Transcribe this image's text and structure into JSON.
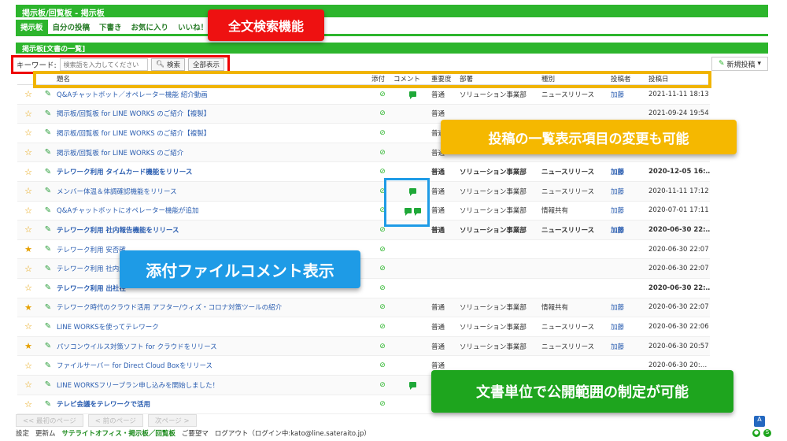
{
  "breadcrumb": "掲示板/回覧板 - 掲示板",
  "nav": {
    "tabs": [
      "掲示板",
      "自分の投稿",
      "下書き",
      "お気に入り",
      "いいね！"
    ]
  },
  "section_title": "掲示板[文書の一覧]",
  "search": {
    "label": "キーワード:",
    "placeholder": "検索語を入力してください",
    "search_button": "検索",
    "show_all_button": "全部表示"
  },
  "new_post_button": "新規投稿",
  "table": {
    "headers": {
      "title": "題名",
      "attachment": "添付",
      "comment": "コメント",
      "importance": "重要度",
      "department": "部署",
      "category": "種別",
      "author": "投稿者",
      "date": "投稿日"
    },
    "rows": [
      {
        "star": "☆",
        "title": "Q&Aチャットボット／オペレーター機能 紹介動画",
        "importance": "普通",
        "dept": "ソリューション事業部",
        "cat": "ニュースリリース",
        "author": "加藤",
        "date": "2021-11-11 18:13",
        "bold": false,
        "comments": 1
      },
      {
        "star": "☆",
        "title": "掲示板/回覧板 for LINE WORKS のご紹介【複製】",
        "importance": "普通",
        "dept": "",
        "cat": "",
        "author": "",
        "date": "2021-09-24 19:54",
        "bold": false,
        "comments": 0
      },
      {
        "star": "☆",
        "title": "掲示板/回覧板 for LINE WORKS のご紹介【複製】",
        "importance": "普通",
        "dept": "",
        "cat": "",
        "author": "",
        "date": "2021-09-24 19:45",
        "bold": false,
        "comments": 0
      },
      {
        "star": "☆",
        "title": "掲示板/回覧板 for LINE WORKS のご紹介",
        "importance": "普通",
        "dept": "",
        "cat": "",
        "author": "",
        "date": "",
        "bold": false,
        "comments": 0
      },
      {
        "star": "☆",
        "title": "テレワーク利用 タイムカード機能をリリース",
        "importance": "普通",
        "dept": "ソリューション事業部",
        "cat": "ニュースリリース",
        "author": "加藤",
        "date": "2020-12-05 16:…",
        "bold": true,
        "comments": 0
      },
      {
        "star": "☆",
        "title": "メンバー体温＆体調確認機能をリリース",
        "importance": "普通",
        "dept": "ソリューション事業部",
        "cat": "ニュースリリース",
        "author": "加藤",
        "date": "2020-11-11 17:12",
        "bold": false,
        "comments": 1
      },
      {
        "star": "☆",
        "title": "Q&Aチャットボットにオペレーター機能が追加",
        "importance": "普通",
        "dept": "ソリューション事業部",
        "cat": "情報共有",
        "author": "加藤",
        "date": "2020-07-01 17:11",
        "bold": false,
        "comments": 2
      },
      {
        "star": "☆",
        "title": "テレワーク利用 社内報告機能をリリース",
        "importance": "普通",
        "dept": "ソリューション事業部",
        "cat": "ニュースリリース",
        "author": "加藤",
        "date": "2020-06-30 22:…",
        "bold": true,
        "comments": 0
      },
      {
        "star": "★",
        "title": "テレワーク利用 安否確",
        "importance": "",
        "dept": "",
        "cat": "",
        "author": "",
        "date": "2020-06-30 22:07",
        "bold": false,
        "comments": 0
      },
      {
        "star": "☆",
        "title": "テレワーク利用 社内連",
        "importance": "",
        "dept": "",
        "cat": "",
        "author": "",
        "date": "2020-06-30 22:07",
        "bold": false,
        "comments": 0
      },
      {
        "star": "☆",
        "title": "テレワーク利用 出社在",
        "importance": "",
        "dept": "",
        "cat": "",
        "author": "",
        "date": "2020-06-30 22:…",
        "bold": true,
        "comments": 0
      },
      {
        "star": "★",
        "title": "テレワーク時代のクラウド活用 アフター/ウィズ・コロナ対策ツールの紹介",
        "importance": "普通",
        "dept": "ソリューション事業部",
        "cat": "情報共有",
        "author": "加藤",
        "date": "2020-06-30 22:07",
        "bold": false,
        "comments": 0
      },
      {
        "star": "☆",
        "title": "LINE WORKSを使ってテレワーク",
        "importance": "普通",
        "dept": "ソリューション事業部",
        "cat": "ニュースリリース",
        "author": "加藤",
        "date": "2020-06-30 22:06",
        "bold": false,
        "comments": 0
      },
      {
        "star": "★",
        "title": "パソコンウイルス対策ソフト for クラウドをリリース",
        "importance": "普通",
        "dept": "ソリューション事業部",
        "cat": "ニュースリリース",
        "author": "加藤",
        "date": "2020-06-30 20:57",
        "bold": false,
        "comments": 0
      },
      {
        "star": "☆",
        "title": "ファイルサーバー for Direct Cloud Boxをリリース",
        "importance": "普通",
        "dept": "",
        "cat": "",
        "author": "",
        "date": "2020-06-30 20:…",
        "bold": false,
        "comments": 0
      },
      {
        "star": "☆",
        "title": "LINE WORKSフリープラン申し込みを開始しました！",
        "importance": "",
        "dept": "",
        "cat": "",
        "author": "",
        "date": "",
        "bold": false,
        "comments": 1
      },
      {
        "star": "☆",
        "title": "テレビ会議をテレワークで活用",
        "importance": "",
        "dept": "",
        "cat": "",
        "author": "",
        "date": "",
        "bold": true,
        "comments": 0
      }
    ]
  },
  "callouts": {
    "search": "全文検索機能",
    "columns": "投稿の一覧表示項目の変更も可能",
    "attachment_comment": "添付ファイルコメント表示",
    "scope": "文書単位で公開範囲の制定が可能"
  },
  "pager": {
    "first": "<< 最初のページ",
    "prev": "< 前のページ",
    "next": "次ページ >"
  },
  "footer": {
    "settings": "設定",
    "update": "更新ム",
    "app_name": "サテライトオフィス・掲示板／回覧板",
    "feedback": "ご要望マ",
    "logout": "ログアウト（ログイン中:kato@line.sateraito.jp）"
  },
  "colors": {
    "brand_green": "#2db52d",
    "callout_red": "#ee1111",
    "callout_yellow": "#f5b800",
    "callout_blue": "#1e9be6",
    "callout_green": "#1ea51e"
  }
}
